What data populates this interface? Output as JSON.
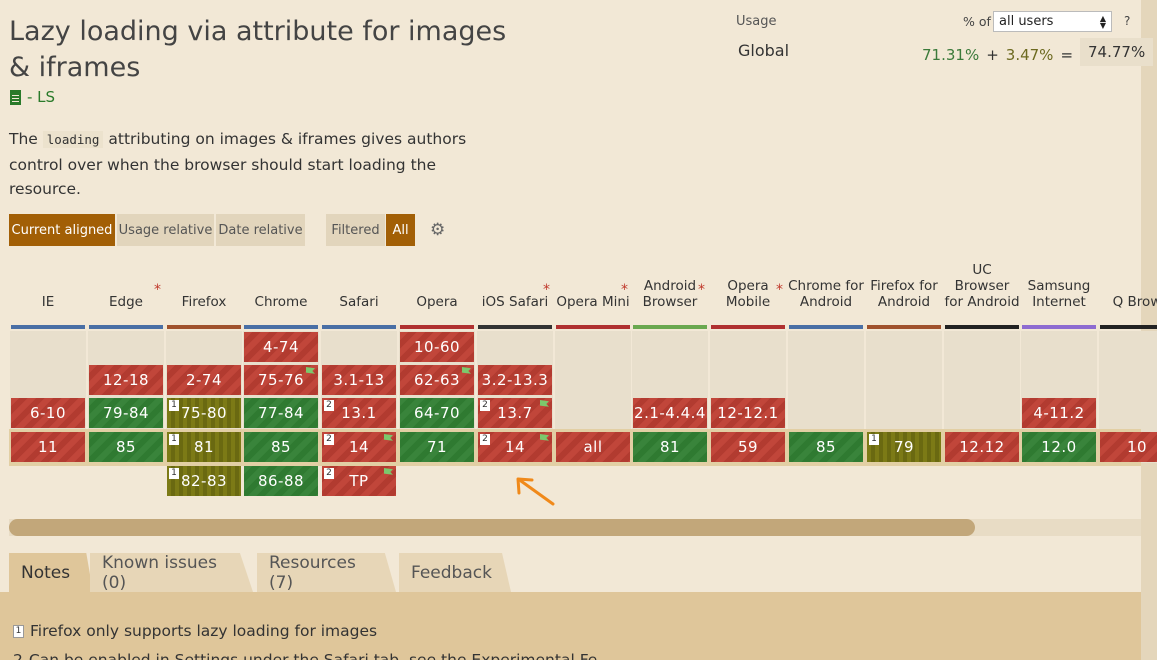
{
  "feature": {
    "title": "Lazy loading via attribute for images & iframes",
    "spec_status": "- LS",
    "desc_before": "The ",
    "desc_code": "loading",
    "desc_after": " attributing on images & iframes gives authors control over when the browser should start loading the resource."
  },
  "usage": {
    "label": "Usage",
    "pct_of": "% of",
    "users_option": "all users",
    "help": "?",
    "region": "Global",
    "full": "71.31%",
    "plus": "+",
    "partial": "3.47%",
    "equals": "=",
    "total": "74.77%"
  },
  "filters": {
    "current_aligned": "Current aligned",
    "usage_relative": "Usage relative",
    "date_relative": "Date relative",
    "filtered": "Filtered",
    "all": "All"
  },
  "colors": {
    "supported": "#39843b",
    "unsupported": "#c1463a",
    "partial": "#7c7a16",
    "accent": "#a25f06"
  },
  "browsers": [
    {
      "name": "IE",
      "bar": "#4a6fa5",
      "star": false
    },
    {
      "name": "Edge",
      "bar": "#4a6fa5",
      "star": true
    },
    {
      "name": "Firefox",
      "bar": "#a0522d",
      "star": false
    },
    {
      "name": "Chrome",
      "bar": "#4a6fa5",
      "star": false
    },
    {
      "name": "Safari",
      "bar": "#4a6fa5",
      "star": false
    },
    {
      "name": "Opera",
      "bar": "#b03030",
      "star": false
    },
    {
      "name": "iOS Safari",
      "bar": "#333333",
      "star": true
    },
    {
      "name": "Opera Mini",
      "bar": "#b03030",
      "star": true
    },
    {
      "name": "Android Browser",
      "bar": "#6aa84f",
      "star": true
    },
    {
      "name": "Opera Mobile",
      "bar": "#b03030",
      "star": true
    },
    {
      "name": "Chrome for Android",
      "bar": "#4a6fa5",
      "star": false
    },
    {
      "name": "Firefox for Android",
      "bar": "#a0522d",
      "star": false
    },
    {
      "name": "UC Browser for Android",
      "bar": "#222222",
      "star": false
    },
    {
      "name": "Samsung Internet",
      "bar": "#8e6bd1",
      "star": false
    },
    {
      "name": "Q Brow",
      "bar": "#222222",
      "star": false
    }
  ],
  "cells": [
    {
      "col": 3,
      "row": 0,
      "v": "4-74",
      "s": "n"
    },
    {
      "col": 5,
      "row": 0,
      "v": "10-60",
      "s": "n"
    },
    {
      "col": 1,
      "row": 1,
      "v": "12-18",
      "s": "n"
    },
    {
      "col": 2,
      "row": 1,
      "v": "2-74",
      "s": "n"
    },
    {
      "col": 3,
      "row": 1,
      "v": "75-76",
      "s": "n",
      "flag": true
    },
    {
      "col": 4,
      "row": 1,
      "v": "3.1-13",
      "s": "n"
    },
    {
      "col": 5,
      "row": 1,
      "v": "62-63",
      "s": "n",
      "flag": true
    },
    {
      "col": 6,
      "row": 1,
      "v": "3.2-13.3",
      "s": "n"
    },
    {
      "col": 0,
      "row": 2,
      "v": "6-10",
      "s": "n"
    },
    {
      "col": 1,
      "row": 2,
      "v": "79-84",
      "s": "y"
    },
    {
      "col": 2,
      "row": 2,
      "v": "75-80",
      "s": "a",
      "note": "1"
    },
    {
      "col": 3,
      "row": 2,
      "v": "77-84",
      "s": "y"
    },
    {
      "col": 4,
      "row": 2,
      "v": "13.1",
      "s": "n",
      "note": "2"
    },
    {
      "col": 5,
      "row": 2,
      "v": "64-70",
      "s": "y"
    },
    {
      "col": 6,
      "row": 2,
      "v": "13.7",
      "s": "n",
      "note": "2",
      "flag": true
    },
    {
      "col": 8,
      "row": 2,
      "v": "2.1-4.4.4",
      "s": "n"
    },
    {
      "col": 9,
      "row": 2,
      "v": "12-12.1",
      "s": "n"
    },
    {
      "col": 13,
      "row": 2,
      "v": "4-11.2",
      "s": "n"
    },
    {
      "col": 0,
      "row": 3,
      "v": "11",
      "s": "n"
    },
    {
      "col": 1,
      "row": 3,
      "v": "85",
      "s": "y"
    },
    {
      "col": 2,
      "row": 3,
      "v": "81",
      "s": "a",
      "note": "1"
    },
    {
      "col": 3,
      "row": 3,
      "v": "85",
      "s": "y"
    },
    {
      "col": 4,
      "row": 3,
      "v": "14",
      "s": "n",
      "note": "2",
      "flag": true
    },
    {
      "col": 5,
      "row": 3,
      "v": "71",
      "s": "y"
    },
    {
      "col": 6,
      "row": 3,
      "v": "14",
      "s": "n",
      "note": "2",
      "flag": true
    },
    {
      "col": 7,
      "row": 3,
      "v": "all",
      "s": "n"
    },
    {
      "col": 8,
      "row": 3,
      "v": "81",
      "s": "y"
    },
    {
      "col": 9,
      "row": 3,
      "v": "59",
      "s": "n"
    },
    {
      "col": 10,
      "row": 3,
      "v": "85",
      "s": "y"
    },
    {
      "col": 11,
      "row": 3,
      "v": "79",
      "s": "a",
      "note": "1"
    },
    {
      "col": 12,
      "row": 3,
      "v": "12.12",
      "s": "n"
    },
    {
      "col": 13,
      "row": 3,
      "v": "12.0",
      "s": "y"
    },
    {
      "col": 14,
      "row": 3,
      "v": "10",
      "s": "n"
    },
    {
      "col": 2,
      "row": 4,
      "v": "82-83",
      "s": "a",
      "note": "1"
    },
    {
      "col": 3,
      "row": 4,
      "v": "86-88",
      "s": "y"
    },
    {
      "col": 4,
      "row": 4,
      "v": "TP",
      "s": "n",
      "note": "2",
      "flag": true
    }
  ],
  "tabs": [
    {
      "label": "Notes",
      "active": true
    },
    {
      "label": "Known issues (0)",
      "active": false
    },
    {
      "label": "Resources (7)",
      "active": false
    },
    {
      "label": "Feedback",
      "active": false
    }
  ],
  "notes": [
    {
      "num": "1",
      "text": "Firefox only supports lazy loading for images"
    },
    {
      "num": "2",
      "text": "Can be enabled in Settings under the Safari tab, see the Experimental Fe"
    }
  ]
}
